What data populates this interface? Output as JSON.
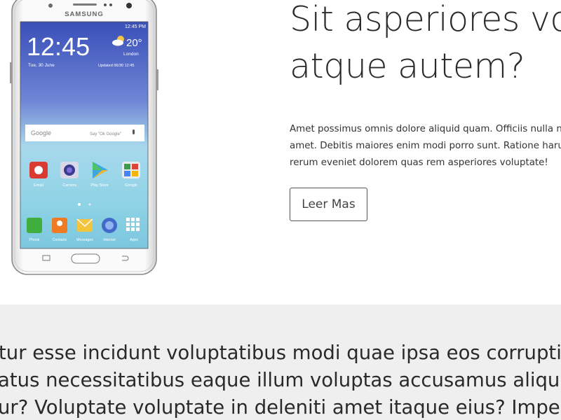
{
  "hero": {
    "title_line1": "Sit asperiores vo",
    "title_line2": "atque autem?",
    "text_lines": [
      "Amet possimus omnis dolore aliquid quam. Officiis nulla n",
      "amet. Debitis maiores enim modi porro sunt. Ratione haru",
      "rerum eveniet dolorem quas rem asperiores voluptate!"
    ],
    "button_label": "Leer Mas"
  },
  "phone": {
    "brand": "SAMSUNG",
    "status_time": "12:45 PM",
    "clock": "12:45",
    "date": "Tue, 30 June",
    "temperature": "20°",
    "city": "London",
    "updated": "Updated 06/30 12:45",
    "search_brand": "Google",
    "search_hint": "Say \"Ok Google\"",
    "apps_row1": [
      "Email",
      "Camera",
      "Play Store",
      "Google"
    ],
    "dock": [
      "Phone",
      "Contacts",
      "Messages",
      "Internet",
      "Apps"
    ]
  },
  "band": {
    "lines": [
      "tur esse incidunt voluptatibus modi quae ipsa eos corrupti a",
      "atus necessitatibus eaque illum voluptas accusamus aliquid",
      "ur? Voluptate voluptate in deleniti amet itaque eius? Impedit"
    ]
  }
}
